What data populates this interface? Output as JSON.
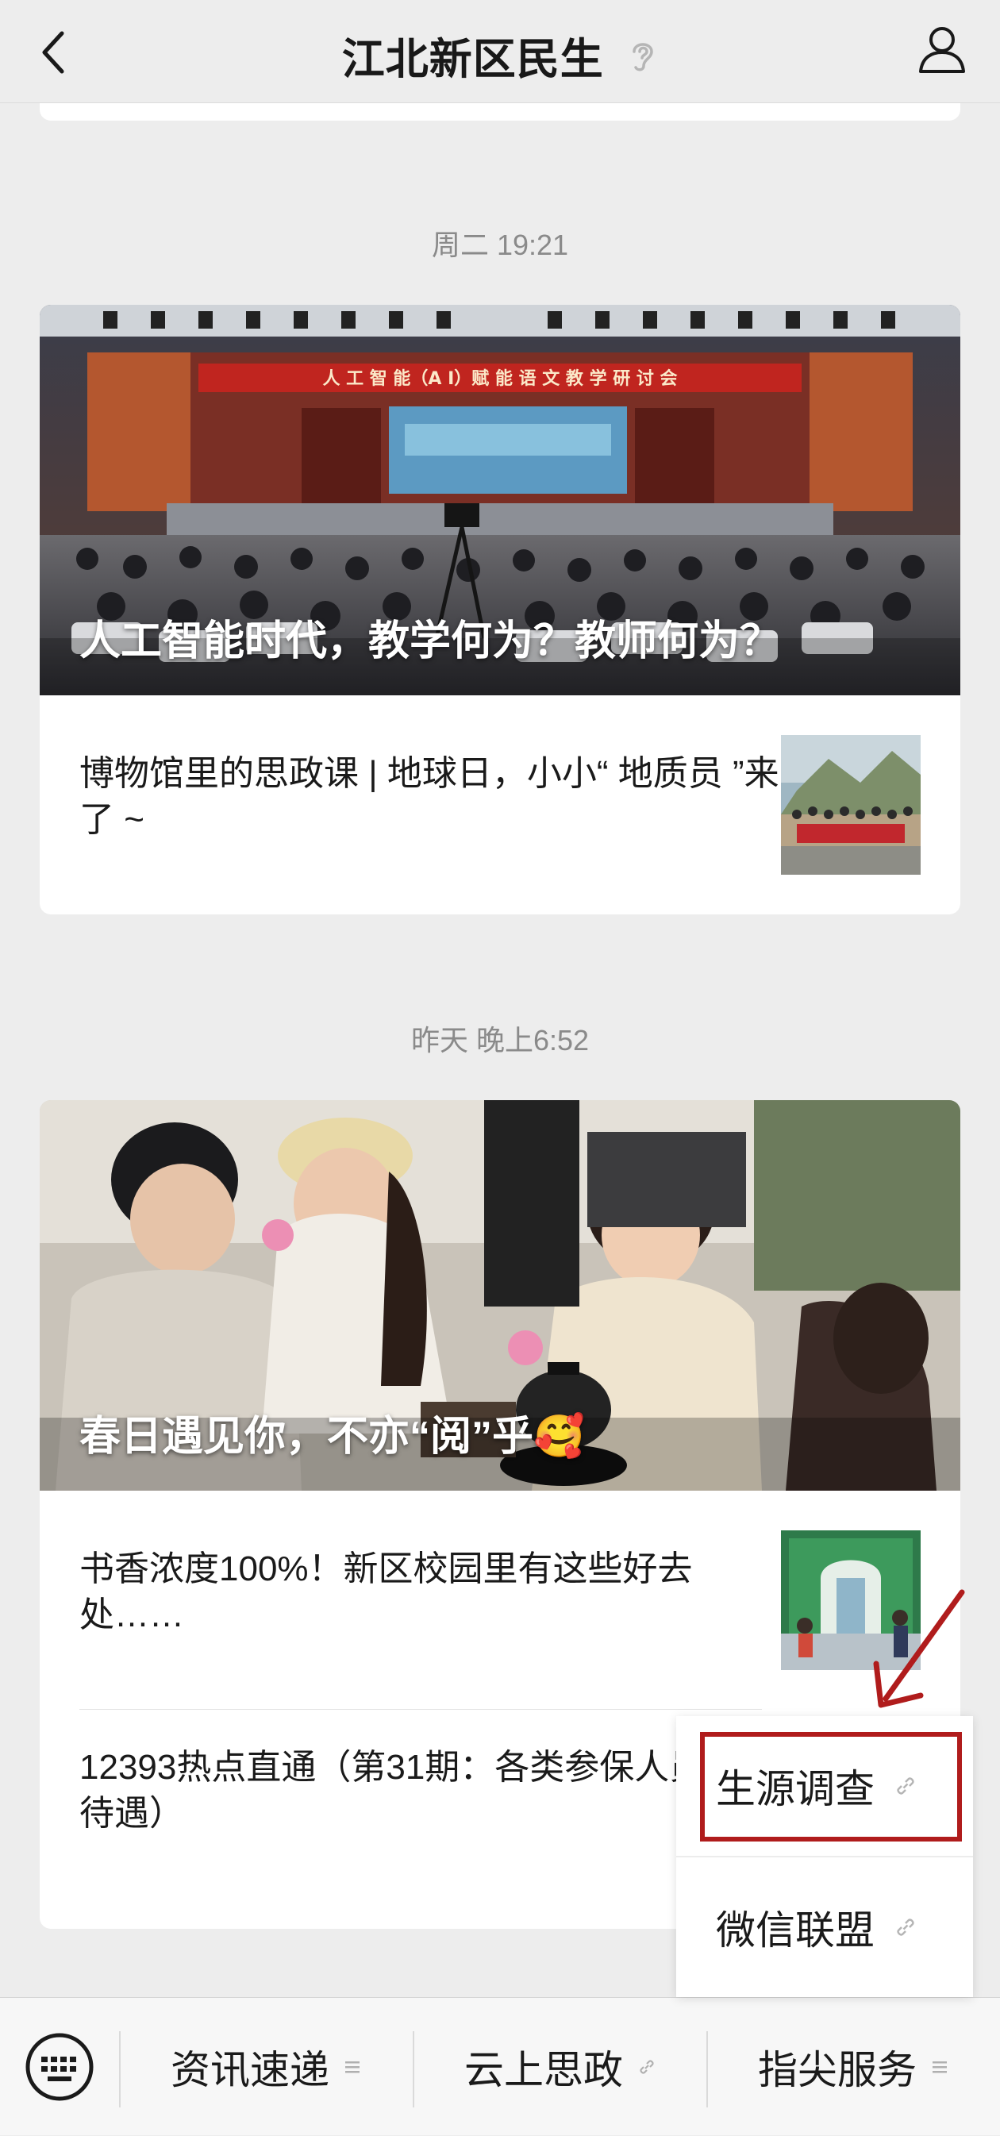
{
  "header": {
    "title": "江北新区民生"
  },
  "feed": [
    {
      "timestamp": "周二 19:21",
      "cover": {
        "title": "人工智能时代，教学何为？教师何为？",
        "banner_text": "人 工 智 能（A I）赋 能 语 文 教 学 研 讨 会"
      },
      "items": [
        {
          "title": "博物馆里的思政课 | 地球日，小小“ 地质员 ”来了 ~"
        }
      ]
    },
    {
      "timestamp": "昨天 晚上6:52",
      "cover": {
        "title": "春日遇见你，不亦“阅”乎🥰"
      },
      "items": [
        {
          "title": "书香浓度100%！新区校园里有这些好去处……"
        },
        {
          "title": "12393热点直通（第31期：各类参保人员生育待遇）"
        }
      ]
    }
  ],
  "bottom_menu": {
    "items": [
      {
        "label": "资讯速递",
        "icon": "menu-lines-icon"
      },
      {
        "label": "云上思政",
        "icon": "link-icon"
      },
      {
        "label": "指尖服务",
        "icon": "menu-lines-icon"
      }
    ]
  },
  "popup_menu": {
    "items": [
      {
        "label": "生源调查",
        "icon": "link-icon"
      },
      {
        "label": "微信联盟",
        "icon": "link-icon"
      }
    ]
  },
  "colors": {
    "background": "#ededed",
    "card": "#ffffff",
    "highlight": "#b01c1c"
  }
}
